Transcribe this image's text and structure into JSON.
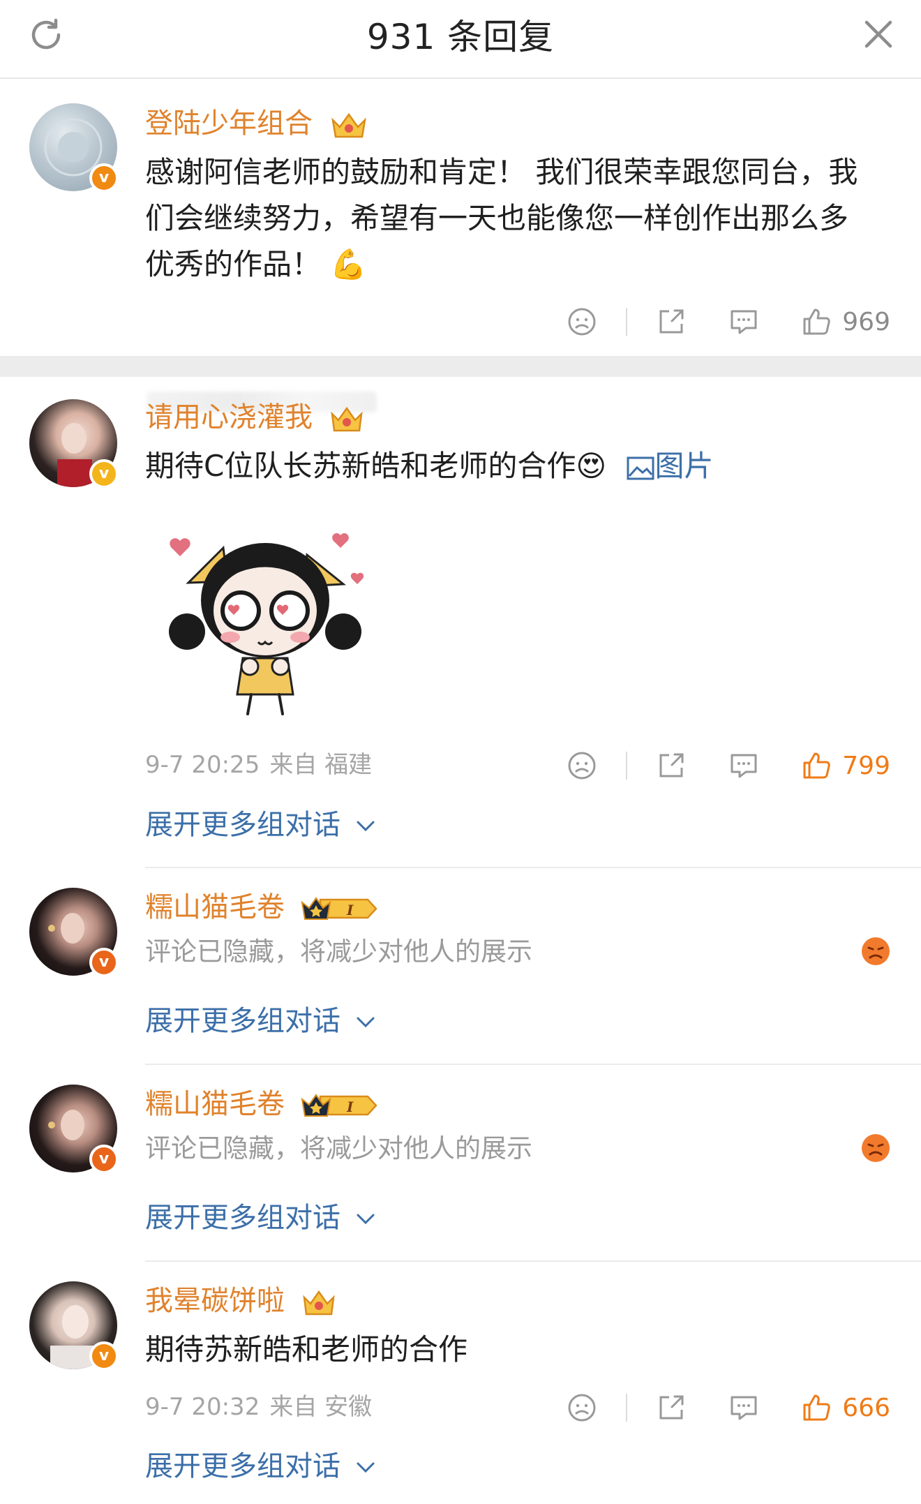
{
  "header": {
    "title": "931 条回复",
    "refresh_icon": "refresh-icon",
    "close_icon": "close-icon"
  },
  "comments": [
    {
      "username": "登陆少年组合",
      "text": "感谢阿信老师的鼓励和肯定！ 我们很荣幸跟您同台，我们会继续努力，希望有一天也能像您一样创作出那么多优秀的作品！",
      "emoji": "💪",
      "likes": "969"
    },
    {
      "username": "请用心浇灌我",
      "text": "期待C位队长苏新皓和老师的合作",
      "emoji": "😍",
      "image_link": "图片",
      "time": "9-7 20:25",
      "from": "来自 福建",
      "likes": "799",
      "expand": "展开更多组对话"
    },
    {
      "username": "糯山猫毛卷",
      "hidden_text": "评论已隐藏，将减少对他人的展示",
      "badge_level": "I",
      "expand": "展开更多组对话"
    },
    {
      "username": "糯山猫毛卷",
      "hidden_text": "评论已隐藏，将减少对他人的展示",
      "badge_level": "I",
      "expand": "展开更多组对话"
    },
    {
      "username": "我晕碳饼啦",
      "text": "期待苏新皓和老师的合作",
      "time": "9-7 20:32",
      "from": "来自 安徽",
      "likes": "666",
      "expand": "展开更多组对话"
    }
  ],
  "colors": {
    "username": "#e0822c",
    "link": "#3c6fa8",
    "meta": "#a5a5a5",
    "like_active": "#f07a16",
    "verified_badge": "#f08a12"
  }
}
